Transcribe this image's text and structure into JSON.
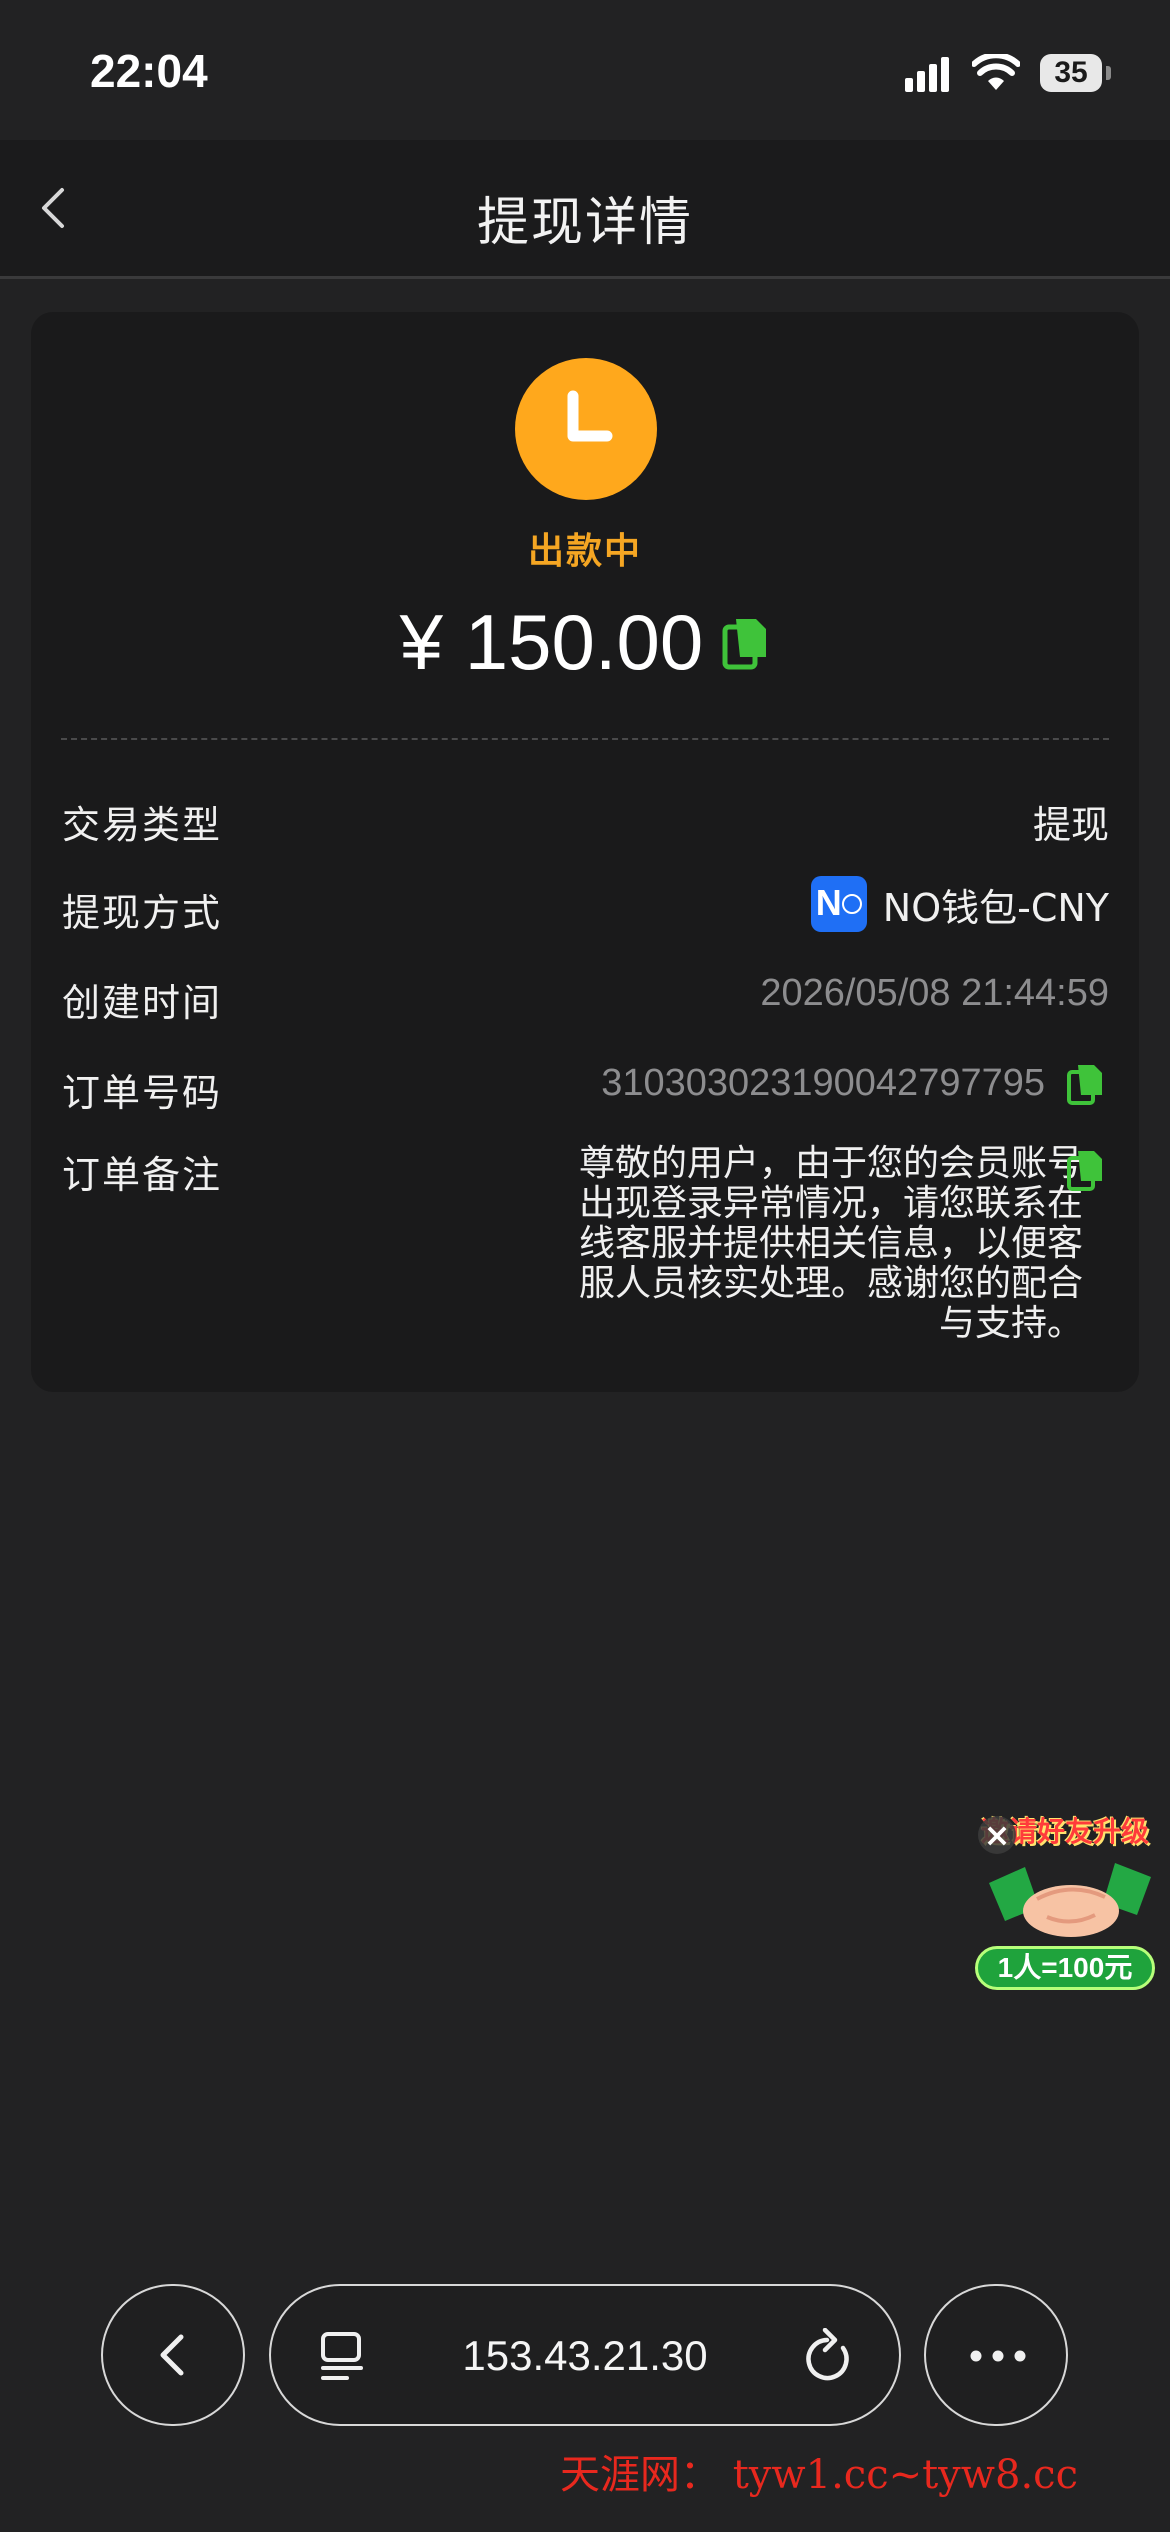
{
  "status_bar": {
    "time": "22:04",
    "battery": "35"
  },
  "nav": {
    "title": "提现详情"
  },
  "detail": {
    "status": "出款中",
    "amount": "¥ 150.00",
    "rows": {
      "type_label": "交易类型",
      "type_value": "提现",
      "method_label": "提现方式",
      "method_value": "NO钱包-CNY",
      "created_label": "创建时间",
      "created_value": "2026/05/08 21:44:59",
      "order_label": "订单号码",
      "order_value": "310303023190042797795",
      "remark_label": "订单备注",
      "remark_lines": [
        "尊敬的用户，由于您的会员账号",
        "出现登录异常情况，请您联系在",
        "线客服并提供相关信息，以便客",
        "服人员核实处理。感谢您的配合",
        "与支持。"
      ]
    }
  },
  "promo": {
    "title": "邀请好友升级",
    "badge": "1人=100元"
  },
  "browser": {
    "url": "153.43.21.30"
  },
  "watermark": "天涯网： tyw1.cc~tyw8.cc",
  "colors": {
    "accent_orange": "#ffa81c",
    "copy_green": "#3fc33a",
    "wallet_blue": "#1f6ff5"
  }
}
